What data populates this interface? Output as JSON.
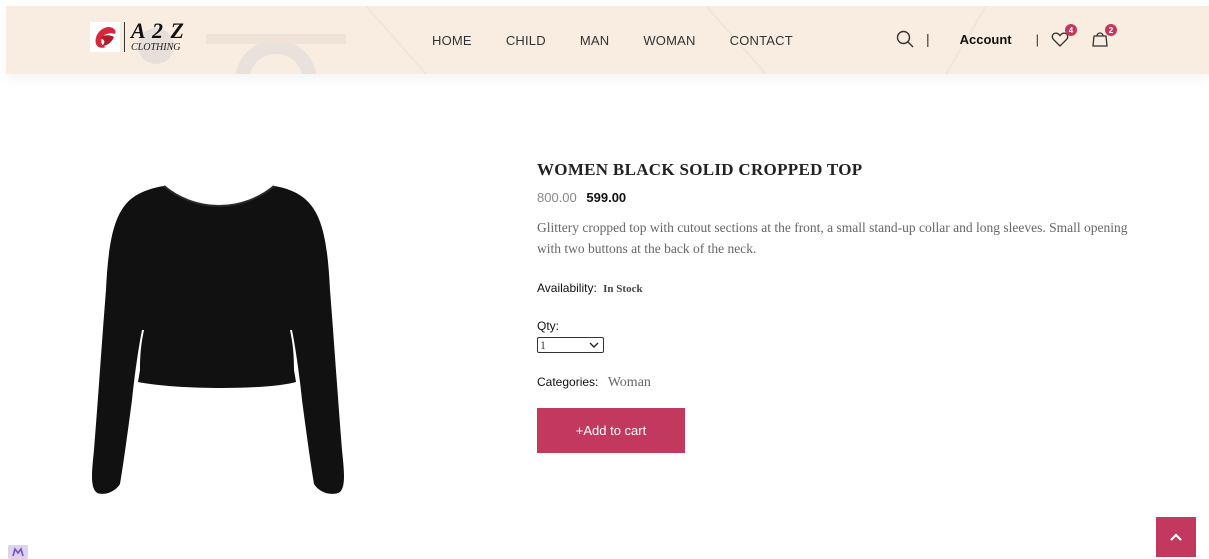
{
  "brand": {
    "logo_main": "A 2 Z",
    "logo_sub": "CLOTHING"
  },
  "nav": {
    "items": [
      "HOME",
      "CHILD",
      "MAN",
      "WOMAN",
      "CONTACT"
    ]
  },
  "header_actions": {
    "account_label": "Account",
    "separator": "|",
    "wishlist_count": "4",
    "cart_count": "2"
  },
  "product": {
    "title": "WOMEN BLACK SOLID CROPPED TOP",
    "old_price": "800.00",
    "new_price": "599.00",
    "description": "Glittery cropped top with cutout sections at the front, a small stand-up collar and long sleeves. Small opening with two buttons at the back of the neck.",
    "availability_label": "Availability:",
    "availability_value": "In Stock",
    "qty_label": "Qty:",
    "qty_value": "1",
    "categories_label": "Categories:",
    "categories_value": "Woman",
    "add_to_cart_label": "+Add to cart"
  },
  "colors": {
    "accent": "#c2385f",
    "header_bg": "#f8ede0"
  },
  "icons": [
    "search-icon",
    "heart-icon",
    "cart-bag-icon",
    "chevron-up-icon",
    "chevron-down-icon"
  ]
}
